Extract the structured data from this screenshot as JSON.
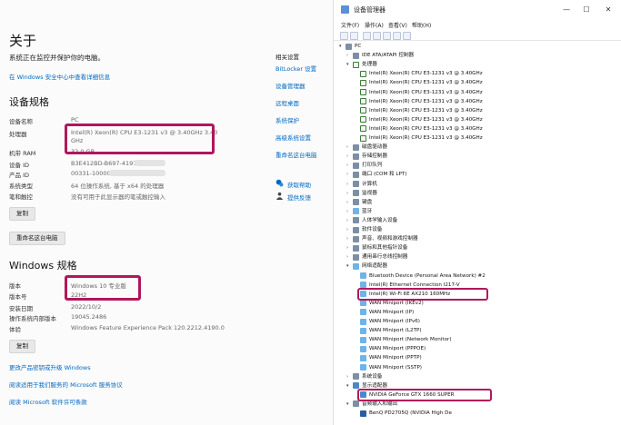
{
  "settings": {
    "title": "关于",
    "warning": "系统正在监控并保护你的电脑。",
    "security_link": "在 Windows 安全中心中查看详细信息",
    "device_spec_heading": "设备规格",
    "device_specs": [
      {
        "key": "设备名称",
        "value": "PC"
      },
      {
        "key": "处理器",
        "value": "Intel(R) Xeon(R) CPU E3-1231 v3 @ 3.40GHz   3.40"
      },
      {
        "key": "",
        "value": "GHz"
      },
      {
        "key": "机带 RAM",
        "value": "32.0 GB"
      },
      {
        "key": "设备 ID",
        "value": "B3E412BD-B697-4197"
      },
      {
        "key": "产品 ID",
        "value": "00331-10000-"
      },
      {
        "key": "系统类型",
        "value": "64 位操作系统, 基于 x64 的处理器"
      },
      {
        "key": "笔和触控",
        "value": "没有可用于此显示器的笔或触控输入"
      }
    ],
    "copy_button": "复制",
    "rename_button": "重命名这台电脑",
    "win_spec_heading": "Windows 规格",
    "win_specs": [
      {
        "key": "版本",
        "value": "Windows 10 专业版"
      },
      {
        "key": "版本号",
        "value": "22H2"
      },
      {
        "key": "安装日期",
        "value": "2022/10/2"
      },
      {
        "key": "操作系统内部版本",
        "value": "19045.2486"
      },
      {
        "key": "体验",
        "value": "Windows Feature Experience Pack 120.2212.4190.0"
      }
    ],
    "copy_button_2": "复制",
    "bottom_links": [
      "更改产品密钥或升级 Windows",
      "阅读适用于我们服务的 Microsoft 服务协议",
      "阅读 Microsoft 软件许可条款"
    ],
    "related_heading": "相关设置",
    "related_links": [
      "BitLocker 设置",
      "设备管理器",
      "远程桌面",
      "系统保护",
      "高级系统设置",
      "重命名这台电脑"
    ],
    "help_links": [
      "获取帮助",
      "提供反馈"
    ]
  },
  "devmgr": {
    "title": "设备管理器",
    "window_buttons": [
      "—",
      "☐",
      "✕"
    ],
    "menu": [
      "文件(F)",
      "操作(A)",
      "查看(V)",
      "帮助(H)"
    ],
    "tree": [
      {
        "label": "PC",
        "level": 0,
        "toggle": "▾",
        "icon": "grp"
      },
      {
        "label": "IDE ATA/ATAPI 控制器",
        "level": 1,
        "toggle": "›",
        "icon": "grp"
      },
      {
        "label": "处理器",
        "level": 1,
        "toggle": "▾",
        "icon": "cpu"
      },
      {
        "label": "Intel(R) Xeon(R) CPU E3-1231 v3 @ 3.40GHz",
        "level": 2,
        "toggle": "",
        "icon": "cpu"
      },
      {
        "label": "Intel(R) Xeon(R) CPU E3-1231 v3 @ 3.40GHz",
        "level": 2,
        "toggle": "",
        "icon": "cpu"
      },
      {
        "label": "Intel(R) Xeon(R) CPU E3-1231 v3 @ 3.40GHz",
        "level": 2,
        "toggle": "",
        "icon": "cpu"
      },
      {
        "label": "Intel(R) Xeon(R) CPU E3-1231 v3 @ 3.40GHz",
        "level": 2,
        "toggle": "",
        "icon": "cpu"
      },
      {
        "label": "Intel(R) Xeon(R) CPU E3-1231 v3 @ 3.40GHz",
        "level": 2,
        "toggle": "",
        "icon": "cpu"
      },
      {
        "label": "Intel(R) Xeon(R) CPU E3-1231 v3 @ 3.40GHz",
        "level": 2,
        "toggle": "",
        "icon": "cpu"
      },
      {
        "label": "Intel(R) Xeon(R) CPU E3-1231 v3 @ 3.40GHz",
        "level": 2,
        "toggle": "",
        "icon": "cpu"
      },
      {
        "label": "Intel(R) Xeon(R) CPU E3-1231 v3 @ 3.40GHz",
        "level": 2,
        "toggle": "",
        "icon": "cpu"
      },
      {
        "label": "磁盘驱动器",
        "level": 1,
        "toggle": "›",
        "icon": "grp"
      },
      {
        "label": "存储控制器",
        "level": 1,
        "toggle": "›",
        "icon": "grp"
      },
      {
        "label": "打印队列",
        "level": 1,
        "toggle": "›",
        "icon": "grp"
      },
      {
        "label": "端口 (COM 和 LPT)",
        "level": 1,
        "toggle": "›",
        "icon": "grp"
      },
      {
        "label": "计算机",
        "level": 1,
        "toggle": "›",
        "icon": "grp"
      },
      {
        "label": "监视器",
        "level": 1,
        "toggle": "›",
        "icon": "grp"
      },
      {
        "label": "键盘",
        "level": 1,
        "toggle": "›",
        "icon": "grp"
      },
      {
        "label": "蓝牙",
        "level": 1,
        "toggle": "›",
        "icon": "net"
      },
      {
        "label": "人体学输入设备",
        "level": 1,
        "toggle": "›",
        "icon": "grp"
      },
      {
        "label": "软件设备",
        "level": 1,
        "toggle": "›",
        "icon": "grp"
      },
      {
        "label": "声音、视频和游戏控制器",
        "level": 1,
        "toggle": "›",
        "icon": "grp"
      },
      {
        "label": "鼠标和其他指针设备",
        "level": 1,
        "toggle": "›",
        "icon": "grp"
      },
      {
        "label": "通用串行总线控制器",
        "level": 1,
        "toggle": "›",
        "icon": "grp"
      },
      {
        "label": "网络适配器",
        "level": 1,
        "toggle": "▾",
        "icon": "net"
      },
      {
        "label": "Bluetooth Device (Personal Area Network) #2",
        "level": 2,
        "toggle": "",
        "icon": "net"
      },
      {
        "label": "Intel(R) Ethernet Connection I217-V",
        "level": 2,
        "toggle": "",
        "icon": "net"
      },
      {
        "label": "Intel(R) Wi-Fi 6E AX210 160MHz",
        "level": 2,
        "toggle": "",
        "icon": "net"
      },
      {
        "label": "WAN Miniport (IKEv2)",
        "level": 2,
        "toggle": "",
        "icon": "net"
      },
      {
        "label": "WAN Miniport (IP)",
        "level": 2,
        "toggle": "",
        "icon": "net"
      },
      {
        "label": "WAN Miniport (IPv6)",
        "level": 2,
        "toggle": "",
        "icon": "net"
      },
      {
        "label": "WAN Miniport (L2TP)",
        "level": 2,
        "toggle": "",
        "icon": "net"
      },
      {
        "label": "WAN Miniport (Network Monitor)",
        "level": 2,
        "toggle": "",
        "icon": "net"
      },
      {
        "label": "WAN Miniport (PPPOE)",
        "level": 2,
        "toggle": "",
        "icon": "net"
      },
      {
        "label": "WAN Miniport (PPTP)",
        "level": 2,
        "toggle": "",
        "icon": "net"
      },
      {
        "label": "WAN Miniport (SSTP)",
        "level": 2,
        "toggle": "",
        "icon": "net"
      },
      {
        "label": "系统设备",
        "level": 1,
        "toggle": "›",
        "icon": "grp"
      },
      {
        "label": "显示适配器",
        "level": 1,
        "toggle": "▾",
        "icon": "disp"
      },
      {
        "label": "NVIDIA GeForce GTX 1660 SUPER",
        "level": 2,
        "toggle": "",
        "icon": "disp"
      },
      {
        "label": "音频输入和输出",
        "level": 1,
        "toggle": "▾",
        "icon": "grp"
      },
      {
        "label": "BenQ PD2705Q (NVIDIA High De",
        "level": 2,
        "toggle": "",
        "icon": "mon"
      }
    ]
  },
  "colors": {
    "highlight": "#b2165c",
    "link": "#0067c0"
  }
}
